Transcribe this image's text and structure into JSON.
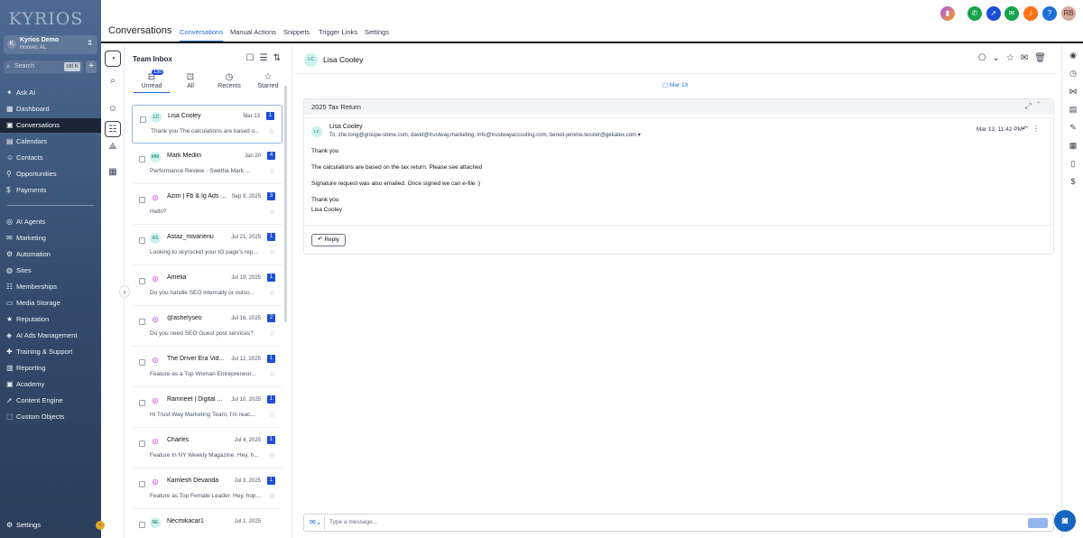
{
  "app": {
    "logo": "KYRIOS",
    "account_name": "Kyrios Demo",
    "account_location": "Hoover, AL",
    "account_initial": "K",
    "search_placeholder": "Search",
    "search_shortcut": "ctrl K"
  },
  "sidebar": {
    "items": [
      {
        "label": "Ask AI",
        "icon": "ai-icon"
      },
      {
        "label": "Dashboard",
        "icon": "dashboard-icon"
      },
      {
        "label": "Conversations",
        "icon": "chat-icon",
        "active": true
      },
      {
        "label": "Calendars",
        "icon": "calendar-icon"
      },
      {
        "label": "Contacts",
        "icon": "contacts-icon"
      },
      {
        "label": "Opportunities",
        "icon": "funnel-icon"
      },
      {
        "label": "Payments",
        "icon": "dollar-icon"
      },
      {
        "label": "AI Agents",
        "icon": "robot-icon"
      },
      {
        "label": "Marketing",
        "icon": "megaphone-icon"
      },
      {
        "label": "Automation",
        "icon": "automation-icon"
      },
      {
        "label": "Sites",
        "icon": "globe-icon"
      },
      {
        "label": "Memberships",
        "icon": "members-icon"
      },
      {
        "label": "Media Storage",
        "icon": "folder-icon"
      },
      {
        "label": "Reputation",
        "icon": "star-icon"
      },
      {
        "label": "AI Ads Management",
        "icon": "ads-icon"
      },
      {
        "label": "Training & Support",
        "icon": "support-icon"
      },
      {
        "label": "Reporting",
        "icon": "chart-icon"
      },
      {
        "label": "Academy",
        "icon": "academy-icon"
      },
      {
        "label": "Content Engine",
        "icon": "rocket-icon"
      },
      {
        "label": "Custom Objects",
        "icon": "objects-icon"
      }
    ],
    "settings_label": "Settings"
  },
  "header": {
    "title": "Conversations",
    "tabs": [
      "Conversations",
      "Manual Actions",
      "Snippets",
      "Trigger Links",
      "Settings"
    ],
    "user_initials": "RB"
  },
  "list": {
    "title": "Team Inbox",
    "filters": [
      {
        "label": "Unread",
        "count": "130"
      },
      {
        "label": "All"
      },
      {
        "label": "Recents"
      },
      {
        "label": "Starred"
      }
    ],
    "conversations": [
      {
        "initials": "LC",
        "name": "Lisa Cooley",
        "date": "Mar 13",
        "unread": "1",
        "preview": "Thank you The calculations are based o...",
        "channel": "email"
      },
      {
        "initials": "MM",
        "name": "Mark Medlin",
        "date": "Jan 20",
        "unread": "4",
        "preview": "Performance Review - Swetha  Mark ...",
        "channel": "email"
      },
      {
        "initials": "",
        "name": "Azim | Fb & Ig Ads ...",
        "date": "Sep 9, 2025",
        "unread": "3",
        "preview": "Hello?",
        "channel": "instagram"
      },
      {
        "initials": "AS",
        "name": "Astaz_mivanenu",
        "date": "Jul 21, 2025",
        "unread": "1",
        "preview": "Looking to skyrocket your IG page's rep...",
        "channel": "instagram"
      },
      {
        "initials": "",
        "name": "Amelia",
        "date": "Jul 19, 2025",
        "unread": "1",
        "preview": "Do you handle SEO internally or outso...",
        "channel": "instagram"
      },
      {
        "initials": "",
        "name": "@ashelyseo",
        "date": "Jul 16, 2025",
        "unread": "2",
        "preview": "Do you need SEO Guest post services?",
        "channel": "instagram"
      },
      {
        "initials": "",
        "name": "The Driver Era Vid...",
        "date": "Jul 12, 2025",
        "unread": "1",
        "preview": "Feature as a Top Woman Entrepreneur...",
        "channel": "instagram"
      },
      {
        "initials": "",
        "name": "Ramneet | Digital ...",
        "date": "Jul 10, 2025",
        "unread": "1",
        "preview": "Hi Trust Way Marketing Team, I'm reac...",
        "channel": "instagram"
      },
      {
        "initials": "",
        "name": "Charles",
        "date": "Jul 4, 2025",
        "unread": "1",
        "preview": "Feature In NY Weekly Magazine. Hey, h...",
        "channel": "instagram"
      },
      {
        "initials": "",
        "name": "Kamlesh Devanda",
        "date": "Jul 3, 2025",
        "unread": "1",
        "preview": "Feature as Top Female Leader. Hey, hop...",
        "channel": "instagram"
      },
      {
        "initials": "NE",
        "name": "Necmikacar1",
        "date": "Jul 1, 2025",
        "unread": "",
        "preview": "",
        "channel": "instagram"
      }
    ]
  },
  "conversation": {
    "contact_initials": "LC",
    "contact_name": "Lisa Cooley",
    "date_divider": "Mar 13",
    "thread_title": "2025 Tax Return",
    "message": {
      "from": "Lisa Cooley",
      "to": "To: zhe.long@groupe-stone.com, david@trustway.marketing, info@trustwayaccouting.com, benoit-jerome.tessler@gekatex.com",
      "time": "Mar 13, 11:42 PM",
      "lines": [
        "Thank you",
        "The calculations are based on the tax return. Please see attached",
        "Signature request was also emailed. Once signed we can e-file :)",
        "Thank you",
        "Lisa Cooley"
      ],
      "reply_label": "Reply"
    },
    "composer_placeholder": "Type a message..."
  },
  "colors": {
    "accent": "#1d6fd8",
    "sidebar_bg": "#3b5277",
    "badge": "#1d4ed8"
  }
}
